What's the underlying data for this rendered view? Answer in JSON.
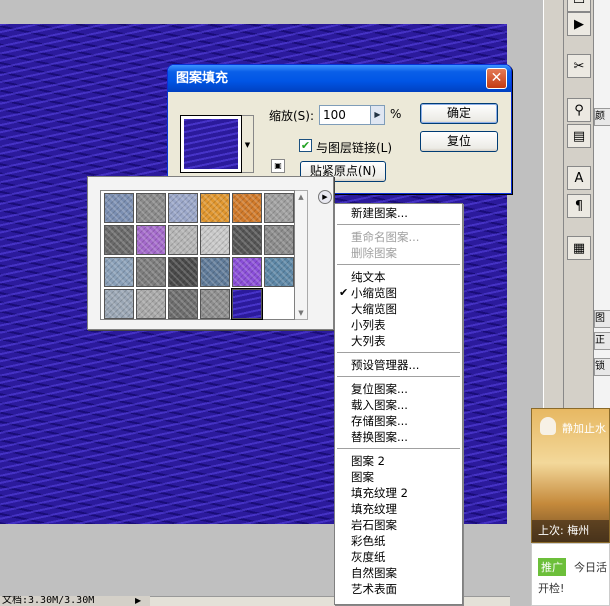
{
  "status_bar": {
    "doc_size": "文档:3.30M/3.30M"
  },
  "dialog": {
    "title": "图案填充",
    "close_glyph": "✕",
    "zoom_label": "缩放(S):",
    "zoom_value": "100",
    "zoom_unit": "%",
    "link_label": "与图层链接(L)",
    "link_checked": true,
    "ok_label": "确定",
    "reset_label": "复位",
    "snap_label": "贴紧原点(N)"
  },
  "picker": {
    "swatches": [
      "#7b8fb2",
      "#8a8a8a",
      "#9aa6c8",
      "#e0962e",
      "#d17a2a",
      "#9f9f9f",
      "#6a6a6a",
      "#a46acb",
      "#b5b5b5",
      "#c8c8c8",
      "#555555",
      "#8c8c8c",
      "#8aa0b8",
      "#7d7d7d",
      "#4a4a4a",
      "#5f7a98",
      "#8a4ed8",
      "#5d87a6",
      "#9aa6b4",
      "#a8a8a8",
      "#6e6e6e",
      "#8e8e8e",
      "#2b1a9c"
    ],
    "selected_index": 22
  },
  "menu": {
    "groups": [
      [
        {
          "label": "新建图案...",
          "enabled": true
        }
      ],
      [
        {
          "label": "重命名图案...",
          "enabled": false
        },
        {
          "label": "删除图案",
          "enabled": false
        }
      ],
      [
        {
          "label": "纯文本",
          "enabled": true
        },
        {
          "label": "小缩览图",
          "enabled": true,
          "checked": true
        },
        {
          "label": "大缩览图",
          "enabled": true
        },
        {
          "label": "小列表",
          "enabled": true
        },
        {
          "label": "大列表",
          "enabled": true
        }
      ],
      [
        {
          "label": "预设管理器...",
          "enabled": true
        }
      ],
      [
        {
          "label": "复位图案...",
          "enabled": true
        },
        {
          "label": "载入图案...",
          "enabled": true
        },
        {
          "label": "存储图案...",
          "enabled": true
        },
        {
          "label": "替换图案...",
          "enabled": true
        }
      ],
      [
        {
          "label": "图案 2",
          "enabled": true
        },
        {
          "label": "图案",
          "enabled": true
        },
        {
          "label": "填充纹理 2",
          "enabled": true
        },
        {
          "label": "填充纹理",
          "enabled": true
        },
        {
          "label": "岩石图案",
          "enabled": true
        },
        {
          "label": "彩色纸",
          "enabled": true
        },
        {
          "label": "灰度纸",
          "enabled": true
        },
        {
          "label": "自然图案",
          "enabled": true
        },
        {
          "label": "艺术表面",
          "enabled": true
        }
      ]
    ],
    "check_glyph": "✔"
  },
  "popup": {
    "title": "静加止水",
    "footer": "上次: 梅州",
    "ad_tag": "推广",
    "ad_text": "今日活",
    "ad_text2": "开检!"
  },
  "panel_tabs": [
    "颜",
    "图",
    "正",
    "锁"
  ],
  "tool_icons": [
    "play-icon",
    "scissors-icon",
    "stamp-icon",
    "text-icon",
    "paragraph-icon",
    "notes-icon"
  ]
}
